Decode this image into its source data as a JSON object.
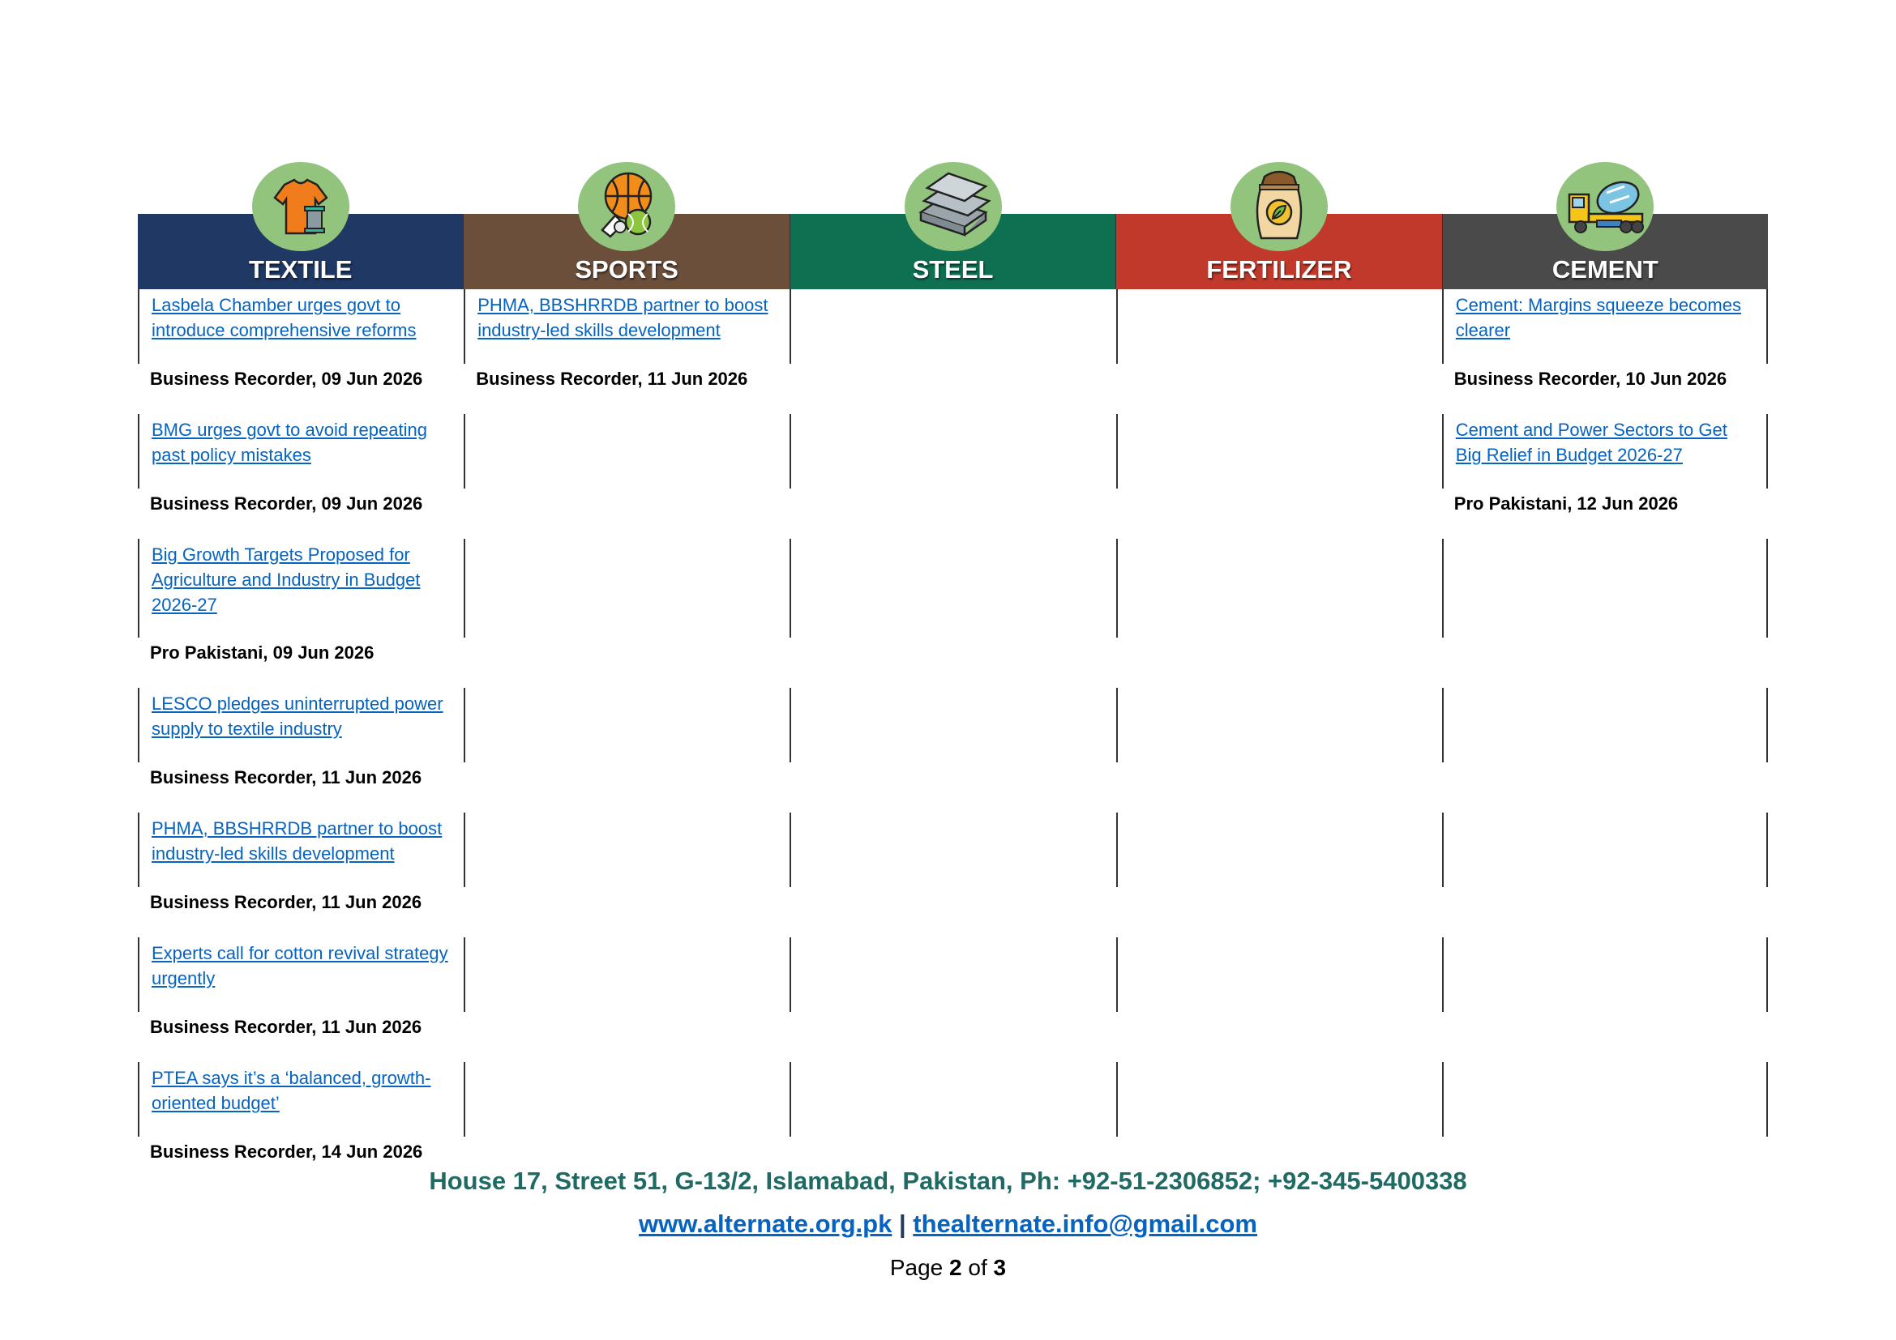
{
  "columns": [
    {
      "title": "TEXTILE",
      "color": "#1f3864",
      "icon": "tshirt-icon"
    },
    {
      "title": "SPORTS",
      "color": "#6b4f3b",
      "icon": "sports-balls-icon"
    },
    {
      "title": "STEEL",
      "color": "#0e7050",
      "icon": "steel-beams-icon"
    },
    {
      "title": "FERTILIZER",
      "color": "#c0392b",
      "icon": "fertilizer-sack-icon"
    },
    {
      "title": "CEMENT",
      "color": "#4a4a4a",
      "icon": "cement-mixer-truck-icon"
    }
  ],
  "rows": [
    [
      {
        "link": "Lasbela Chamber urges govt to introduce comprehensive reforms",
        "source": "Business Recorder, 09 Jun 2026"
      },
      {
        "link": "PHMA, BBSHRRDB partner to boost industry-led skills development",
        "source": "Business Recorder, 11 Jun 2026"
      },
      null,
      null,
      {
        "link": "Cement: Margins squeeze becomes clearer",
        "source": "Business Recorder, 10 Jun 2026"
      }
    ],
    [
      {
        "link": "BMG urges govt to avoid repeating past policy mistakes",
        "source": "Business Recorder, 09 Jun 2026"
      },
      null,
      null,
      null,
      {
        "link": "Cement and Power Sectors to Get Big Relief in Budget 2026-27",
        "source": "Pro Pakistani, 12 Jun 2026"
      }
    ],
    [
      {
        "link": "Big Growth Targets Proposed for Agriculture and Industry in Budget 2026-27",
        "source": "Pro Pakistani, 09 Jun 2026"
      },
      null,
      null,
      null,
      null
    ],
    [
      {
        "link": "LESCO pledges uninterrupted power supply to textile industry",
        "source": "Business Recorder, 11 Jun 2026"
      },
      null,
      null,
      null,
      null
    ],
    [
      {
        "link": "PHMA, BBSHRRDB partner to boost industry-led skills development",
        "source": "Business Recorder, 11 Jun 2026"
      },
      null,
      null,
      null,
      null
    ],
    [
      {
        "link": "Experts call for cotton revival strategy urgently",
        "source": "Business Recorder, 11 Jun 2026"
      },
      null,
      null,
      null,
      null
    ],
    [
      {
        "link": "PTEA says it’s a ‘balanced, growth-oriented budget’",
        "source": "Business Recorder, 14 Jun 2026"
      },
      null,
      null,
      null,
      null
    ]
  ],
  "footer": {
    "address": "House 17, Street 51, G-13/2, Islamabad, Pakistan, Ph: +92-51-2306852; +92-345-5400338",
    "website": "www.alternate.org.pk",
    "separator": "|",
    "email": "thealternate.info@gmail.com",
    "page_label": "Page",
    "page_current": "2",
    "page_of": "of",
    "page_total": "3"
  }
}
